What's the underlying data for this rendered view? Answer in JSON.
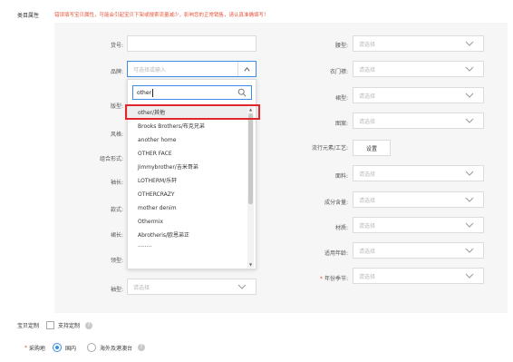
{
  "section": {
    "label": "类目属性",
    "notice": "错误填写宝贝属性，可能会引起宝贝下架或搜索流量减少，影响您的正常销售，请认真准确填写！"
  },
  "left_fields": [
    {
      "label": "货号:",
      "value": "",
      "placeholder": ""
    },
    {
      "label": "品牌:",
      "value": "",
      "placeholder": "可选择或输入"
    },
    {
      "label": "版型:",
      "value": ""
    },
    {
      "label": "风格:",
      "value": ""
    },
    {
      "label": "组合形式:",
      "value": ""
    },
    {
      "label": "袖长:",
      "value": ""
    },
    {
      "label": "款式:",
      "value": ""
    },
    {
      "label": "裙长:",
      "value": ""
    },
    {
      "label": "领型:",
      "value": ""
    },
    {
      "label": "袖型:",
      "value": "",
      "placeholder": "请选择"
    }
  ],
  "right_fields": [
    {
      "label": "腰型:",
      "placeholder": "请选择",
      "required": false
    },
    {
      "label": "衣门襟:",
      "placeholder": "请选择",
      "required": false
    },
    {
      "label": "裙型:",
      "placeholder": "请选择",
      "required": false
    },
    {
      "label": "图案:",
      "placeholder": "请选择",
      "required": false
    },
    {
      "label": "流行元素/工艺:",
      "button": "设置",
      "required": false
    },
    {
      "label": "面料:",
      "placeholder": "请选择",
      "required": false
    },
    {
      "label": "成分含量:",
      "placeholder": "请选择",
      "required": false
    },
    {
      "label": "材质:",
      "placeholder": "请选择",
      "required": false
    },
    {
      "label": "适用年龄:",
      "placeholder": "请选择",
      "required": false
    },
    {
      "label": "年份季节:",
      "placeholder": "请选择",
      "required": true
    }
  ],
  "brand_dropdown": {
    "search_value": "other",
    "items": [
      "other/其他",
      "Brooks Brothers/布克兄弟",
      "another home",
      "OTHER FACE",
      "Jimmybrother/吉米哥弟",
      "LOTHERM/乐轩",
      "OTHERCRAZY",
      "mother denim",
      "Othermix",
      "Abrotheris/欧恩弟正",
      "........"
    ],
    "highlighted_index": 0
  },
  "customize": {
    "label": "宝贝定制",
    "checkbox_label": "支持定制",
    "checked": false
  },
  "purchase_location": {
    "label": "采购地",
    "required": true,
    "options": [
      "国内",
      "海外及港澳台"
    ],
    "selected_index": 0
  },
  "colors": {
    "accent": "#3a8ee6",
    "highlight_border": "#e0272b",
    "required": "#e6553a"
  },
  "icons": {
    "chevron": "chevron-down-icon",
    "chevron_up": "chevron-up-icon",
    "search": "search-icon",
    "help": "help-icon"
  }
}
